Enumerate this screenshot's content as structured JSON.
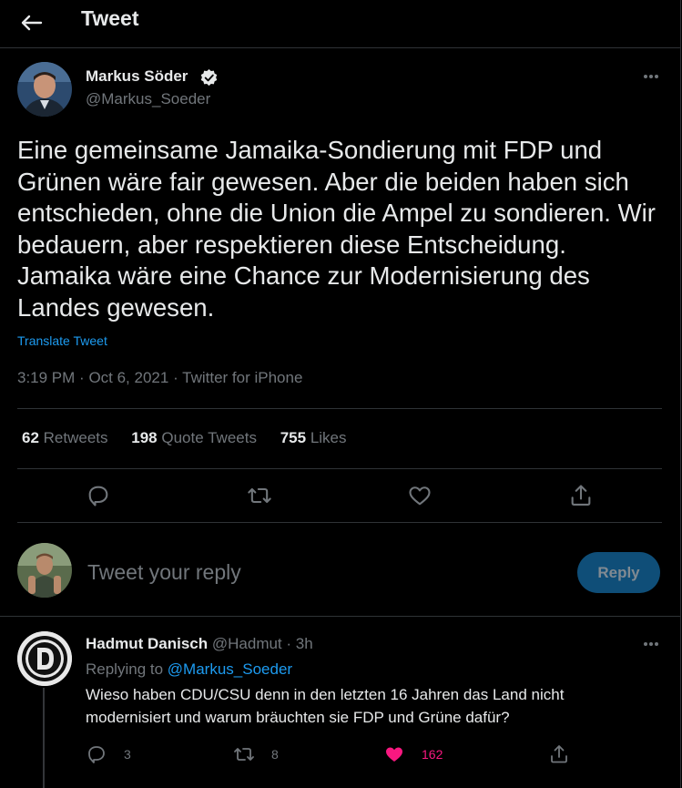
{
  "header": {
    "title": "Tweet",
    "back_icon": "arrow-left-icon"
  },
  "tweet": {
    "author_name": "Markus Söder",
    "author_handle": "@Markus_Soeder",
    "text": "Eine gemeinsame Jamaika-Sondierung mit FDP und Grünen wäre fair gewesen. Aber die beiden haben sich entschieden, ohne die Union die Ampel zu sondieren. Wir bedauern, aber respektieren diese Entscheidung. Jamaika wäre eine Chance zur Modernisierung des Landes gewesen.",
    "translate_label": "Translate Tweet",
    "time": "3:19 PM",
    "date": "Oct 6, 2021",
    "source": "Twitter for iPhone",
    "stats": {
      "retweets": "62",
      "retweets_label": "Retweets",
      "quotes": "198",
      "quotes_label": "Quote Tweets",
      "likes": "755",
      "likes_label": "Likes"
    }
  },
  "composer": {
    "placeholder": "Tweet your reply",
    "button_label": "Reply"
  },
  "reply": {
    "author_name": "Hadmut Danisch",
    "author_handle": "@Hadmut",
    "age": "3h",
    "replying_prefix": "Replying to",
    "replying_to": "@Markus_Soeder",
    "text": "Wieso haben CDU/CSU denn in den letzten 16 Jahren das Land nicht modernisiert und warum bräuchten sie FDP und Grüne dafür?",
    "reply_count": "3",
    "retweet_count": "8",
    "like_count": "162"
  },
  "colors": {
    "accent": "#1d9bf0",
    "like_active": "#f91880",
    "background": "#000000",
    "secondary_text": "#71767b"
  }
}
